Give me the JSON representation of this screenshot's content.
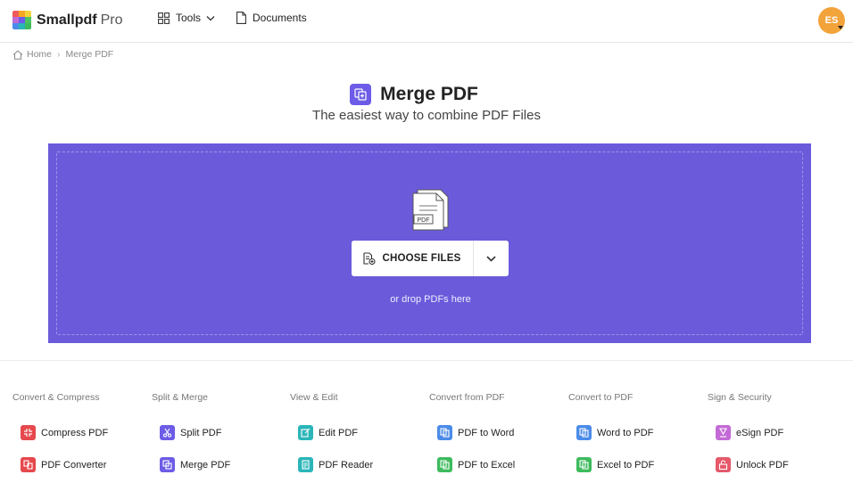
{
  "header": {
    "logo_name": "Smallpdf",
    "logo_plan": "Pro",
    "nav": {
      "tools_label": "Tools",
      "documents_label": "Documents"
    },
    "avatar_initials": "ES"
  },
  "breadcrumb": {
    "home": "Home",
    "current": "Merge PDF"
  },
  "page": {
    "title": "Merge PDF",
    "subtitle": "The easiest way to combine PDF Files"
  },
  "dropzone": {
    "choose_label": "CHOOSE FILES",
    "drop_hint": "or drop PDFs here",
    "illustration_label": "PDF",
    "background_color": "#6b5bdb"
  },
  "tool_columns": [
    {
      "heading": "Convert & Compress",
      "tools": [
        {
          "label": "Compress PDF",
          "icon": "compress-icon",
          "color": "#e5484d"
        },
        {
          "label": "PDF Converter",
          "icon": "converter-icon",
          "color": "#e5484d"
        }
      ]
    },
    {
      "heading": "Split & Merge",
      "tools": [
        {
          "label": "Split PDF",
          "icon": "scissors-icon",
          "color": "#6c5ce7"
        },
        {
          "label": "Merge PDF",
          "icon": "merge-icon",
          "color": "#6c5ce7"
        }
      ]
    },
    {
      "heading": "View & Edit",
      "tools": [
        {
          "label": "Edit PDF",
          "icon": "edit-icon",
          "color": "#2bb5b8"
        },
        {
          "label": "PDF Reader",
          "icon": "reader-icon",
          "color": "#2bb5b8"
        }
      ]
    },
    {
      "heading": "Convert from PDF",
      "tools": [
        {
          "label": "PDF to Word",
          "icon": "word-icon",
          "color": "#4a8be8"
        },
        {
          "label": "PDF to Excel",
          "icon": "excel-icon",
          "color": "#3dbb5d"
        }
      ]
    },
    {
      "heading": "Convert to PDF",
      "tools": [
        {
          "label": "Word to PDF",
          "icon": "word-icon",
          "color": "#4a8be8"
        },
        {
          "label": "Excel to PDF",
          "icon": "excel-icon",
          "color": "#3dbb5d"
        }
      ]
    },
    {
      "heading": "Sign & Security",
      "tools": [
        {
          "label": "eSign PDF",
          "icon": "esign-icon",
          "color": "#c46ad6"
        },
        {
          "label": "Unlock PDF",
          "icon": "unlock-icon",
          "color": "#e5596b"
        }
      ]
    }
  ]
}
